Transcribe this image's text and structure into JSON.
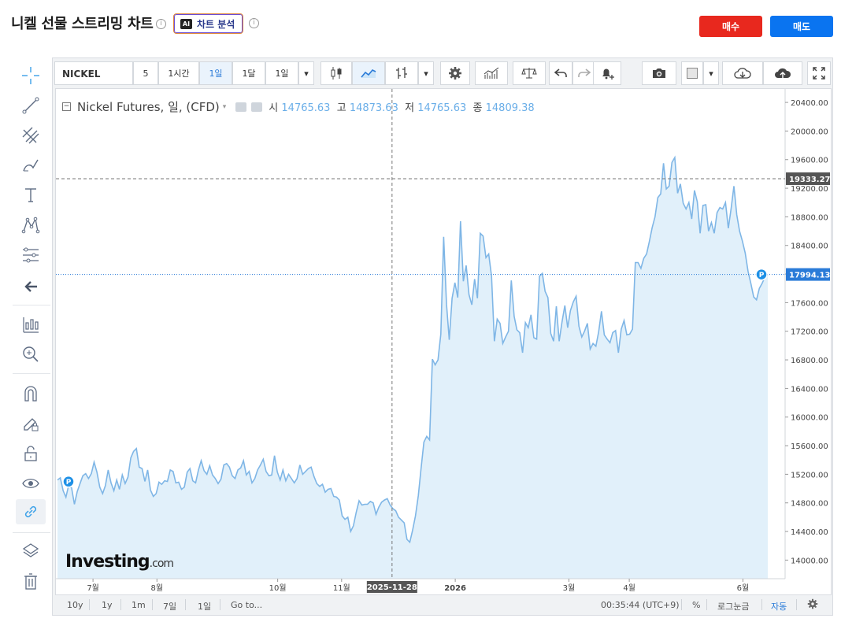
{
  "header": {
    "title": "니켈 선물 스트리밍 차트",
    "ai_badge_icon": "AI",
    "ai_badge_label": "차트 분석",
    "buy_label": "매수",
    "sell_label": "매도",
    "colors": {
      "buy": "#e8281e",
      "sell": "#0a74f0"
    }
  },
  "toolbar": {
    "symbol": "NICKEL",
    "intervals": [
      "5",
      "1시간",
      "1일",
      "1달",
      "1일"
    ],
    "selected_interval": "1일"
  },
  "legend": {
    "name": "Nickel Futures, 일, (CFD)",
    "open_label": "시",
    "open": "14765.63",
    "high_label": "고",
    "high": "14873.63",
    "low_label": "저",
    "low": "14765.63",
    "close_label": "종",
    "close": "14809.38"
  },
  "watermark": {
    "brand": "Investing",
    "suffix": ".com"
  },
  "chart_data": {
    "type": "area",
    "series": [
      {
        "name": "Nickel Futures",
        "values": [
          15120,
          15150,
          14970,
          14880,
          15050,
          15010,
          14780,
          14960,
          15070,
          15180,
          15210,
          15140,
          15210,
          15370,
          15230,
          15020,
          14930,
          15040,
          15260,
          15080,
          14970,
          15120,
          14990,
          15190,
          15070,
          15160,
          15430,
          15520,
          15560,
          15300,
          15280,
          15100,
          15260,
          14980,
          14890,
          14930,
          15090,
          15060,
          15110,
          15100,
          15260,
          15240,
          15080,
          15090,
          14990,
          15020,
          15230,
          15280,
          15110,
          15080,
          15260,
          15390,
          15250,
          15200,
          15320,
          15190,
          15140,
          15070,
          15130,
          15330,
          15350,
          15300,
          15180,
          15140,
          15260,
          15290,
          15390,
          15190,
          15240,
          15080,
          15140,
          15260,
          15330,
          15410,
          15240,
          15180,
          15190,
          15460,
          15230,
          15120,
          15260,
          15110,
          15200,
          15140,
          15080,
          15140,
          15330,
          15200,
          15240,
          15280,
          15300,
          15170,
          15070,
          15030,
          15060,
          14950,
          14990,
          15000,
          14890,
          14880,
          14840,
          14620,
          14570,
          14600,
          14400,
          14480,
          14670,
          14830,
          14770,
          14780,
          14780,
          14820,
          14800,
          14640,
          14740,
          14810,
          14840,
          14860,
          14770,
          14720,
          14690,
          14600,
          14560,
          14520,
          14290,
          14250,
          14420,
          14620,
          14900,
          15280,
          15650,
          15730,
          15680,
          16810,
          16730,
          16800,
          17160,
          18520,
          17580,
          17080,
          17660,
          17880,
          17670,
          18740,
          17900,
          18120,
          17710,
          17570,
          17930,
          17660,
          18570,
          18530,
          18230,
          18280,
          17970,
          17060,
          17370,
          17310,
          17030,
          17120,
          17200,
          17910,
          17410,
          17220,
          17180,
          16900,
          17320,
          17250,
          17430,
          17110,
          17090,
          17970,
          18010,
          17760,
          17670,
          17170,
          17060,
          17550,
          17060,
          17330,
          17560,
          17250,
          17490,
          17610,
          17690,
          17270,
          17120,
          17200,
          17310,
          16950,
          17030,
          16990,
          17190,
          17480,
          17150,
          17090,
          17040,
          17180,
          17210,
          16900,
          17230,
          17350,
          17150,
          17160,
          17230,
          18160,
          18160,
          18080,
          18220,
          18280,
          18460,
          18650,
          18800,
          19070,
          19120,
          19550,
          19190,
          19230,
          19560,
          19630,
          19130,
          19260,
          18990,
          18910,
          19000,
          18770,
          19170,
          19010,
          18570,
          18960,
          18970,
          18600,
          18720,
          18570,
          18860,
          18930,
          18910,
          19000,
          18640,
          18920,
          19230,
          18830,
          18600,
          18460,
          18290,
          18040,
          17870,
          17680,
          17640,
          17800,
          17870,
          17960,
          17994.13
        ]
      }
    ],
    "x_ticks": [
      "7월",
      "8월",
      "10월",
      "11월",
      "2026",
      "3월",
      "4월",
      "6월"
    ],
    "crosshair_x_label": "2025-11-28",
    "y_ticks": [
      "20400.00",
      "20000.00",
      "19600.00",
      "19200.00",
      "18800.00",
      "18400.00",
      "18000.00",
      "17600.00",
      "17200.00",
      "16800.00",
      "16400.00",
      "16000.00",
      "15600.00",
      "15200.00",
      "14800.00",
      "14400.00",
      "14000.00"
    ],
    "ylim": [
      13850,
      20500
    ],
    "crosshair_price": "19333.27",
    "last_price": "17994.13",
    "line_color": "#7fb6e6",
    "fill_color": "#e1f0fa",
    "last_price_color": "#2a7bd8"
  },
  "bottom": {
    "ranges": [
      "10y",
      "1y",
      "1m",
      "7일",
      "1일"
    ],
    "goto": "Go to...",
    "clock": "00:35:44 (UTC+9)",
    "percent": "%",
    "log": "로그눈금",
    "auto": "자동"
  }
}
